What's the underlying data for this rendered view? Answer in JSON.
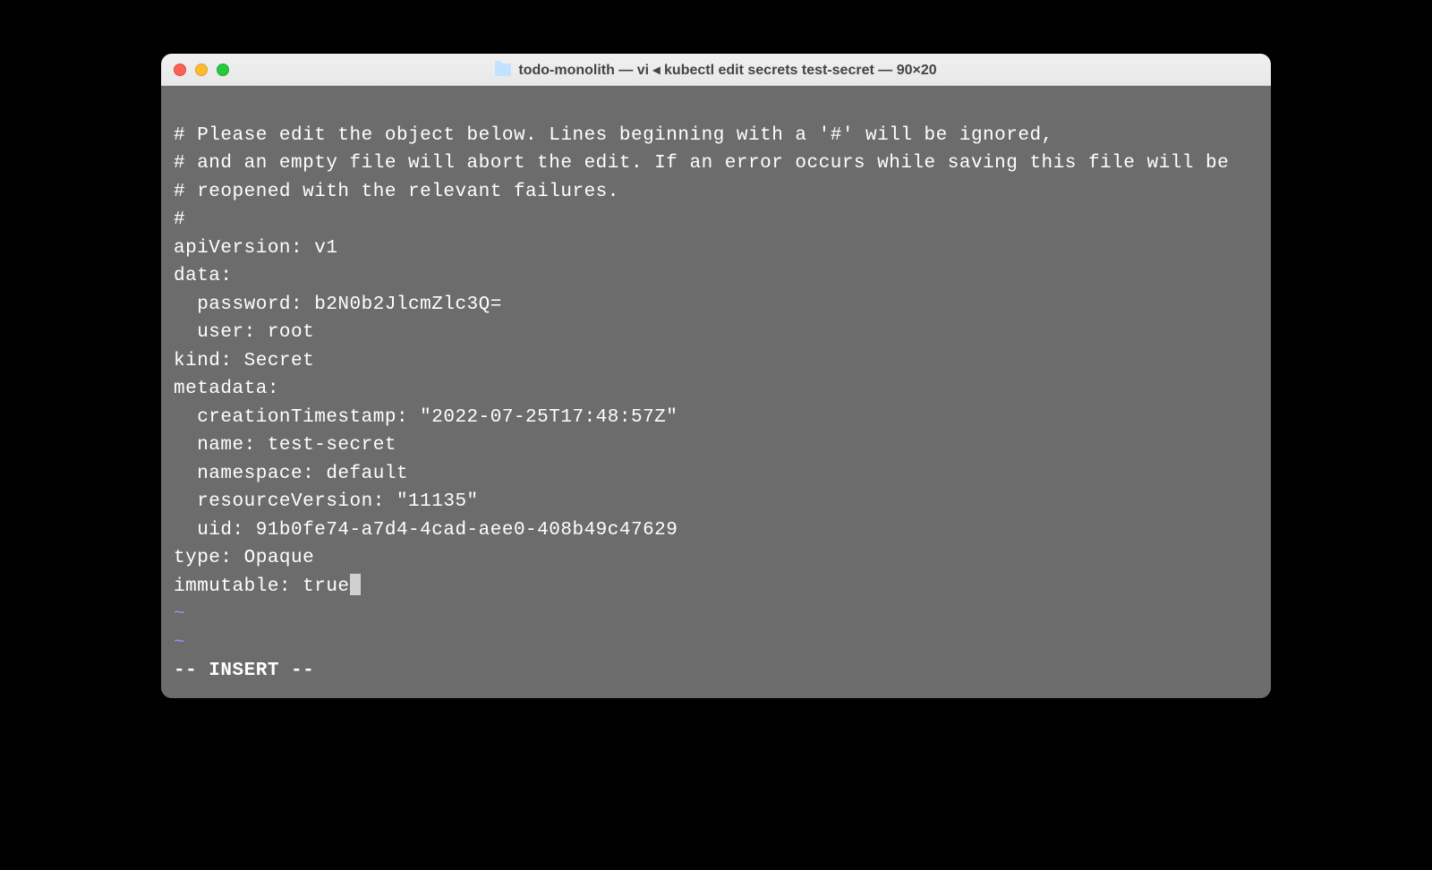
{
  "window": {
    "title": "todo-monolith — vi ◂ kubectl edit secrets test-secret — 90×20"
  },
  "editor": {
    "lines": {
      "comment1": "# Please edit the object below. Lines beginning with a '#' will be ignored,",
      "comment2": "# and an empty file will abort the edit. If an error occurs while saving this file will be",
      "comment3": "# reopened with the relevant failures.",
      "comment4": "#",
      "apiVersion": "apiVersion: v1",
      "dataHeader": "data:",
      "password": "  password: b2N0b2JlcmZlc3Q=",
      "user": "  user: root",
      "kind": "kind: Secret",
      "metadataHeader": "metadata:",
      "creationTimestamp": "  creationTimestamp: \"2022-07-25T17:48:57Z\"",
      "name": "  name: test-secret",
      "namespace": "  namespace: default",
      "resourceVersion": "  resourceVersion: \"11135\"",
      "uid": "  uid: 91b0fe74-a7d4-4cad-aee0-408b49c47629",
      "type": "type: Opaque",
      "immutable": "immutable: true"
    },
    "tilde": "~",
    "statusLine": "-- INSERT --"
  }
}
